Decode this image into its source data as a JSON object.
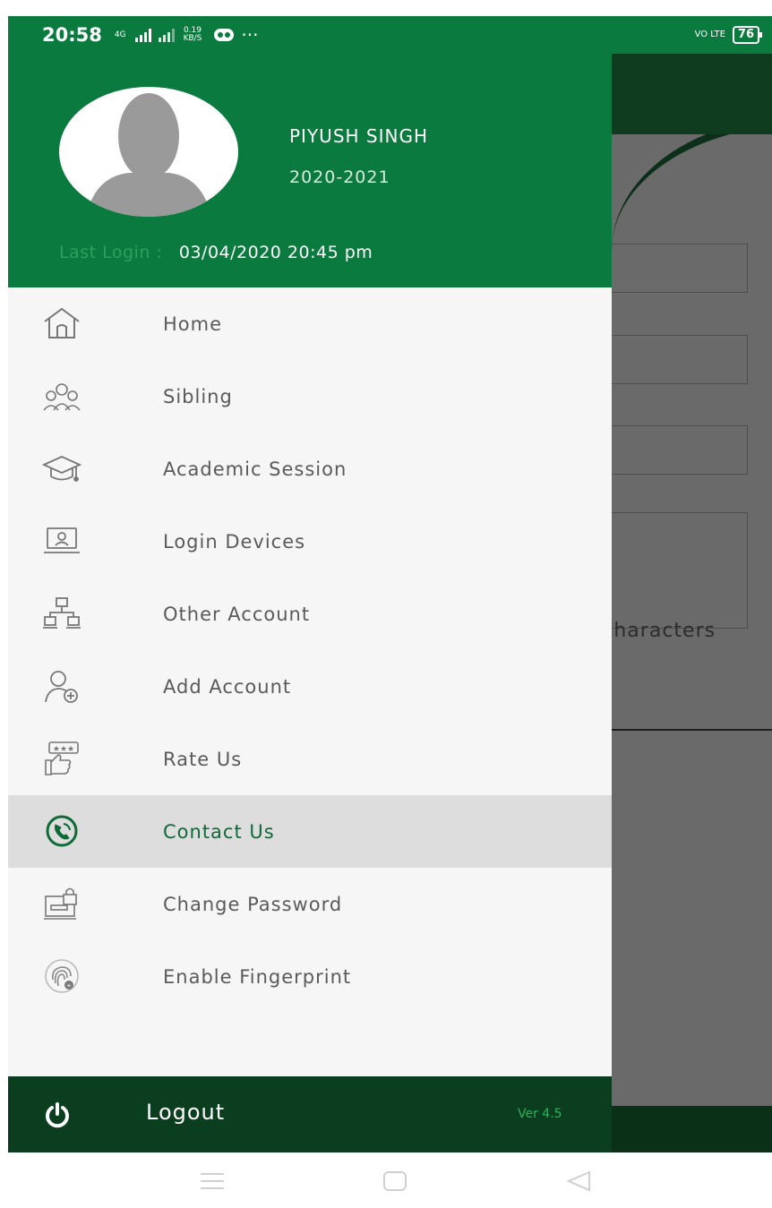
{
  "status_bar": {
    "time": "20:58",
    "network_type": "4G",
    "net_speed_value": "0.19",
    "net_speed_unit": "KB/S",
    "overflow": "···",
    "volte": "VO LTE",
    "battery": "76"
  },
  "profile": {
    "name": "PIYUSH  SINGH",
    "session": "2020-2021",
    "last_login_label": "Last Login :",
    "last_login_value": "03/04/2020  20:45 pm"
  },
  "menu": {
    "items": [
      {
        "label": "Home",
        "icon": "home-icon"
      },
      {
        "label": "Sibling",
        "icon": "sibling-icon"
      },
      {
        "label": "Academic Session",
        "icon": "graduation-cap-icon"
      },
      {
        "label": "Login Devices",
        "icon": "laptop-user-icon"
      },
      {
        "label": "Other Account",
        "icon": "network-computers-icon"
      },
      {
        "label": "Add Account",
        "icon": "add-user-icon"
      },
      {
        "label": "Rate Us",
        "icon": "rating-thumbs-up-icon"
      },
      {
        "label": "Contact Us",
        "icon": "phone-call-icon",
        "active": true
      },
      {
        "label": "Change Password",
        "icon": "password-lock-icon"
      },
      {
        "label": "Enable Fingerprint",
        "icon": "fingerprint-icon"
      }
    ]
  },
  "footer": {
    "logout_label": "Logout",
    "version": "Ver 4.5"
  },
  "background": {
    "hint_text": "Characters"
  },
  "colors": {
    "primary_green": "#0a7a3e",
    "dark_green": "#0b3d1f",
    "active_text": "#0e6a36",
    "active_bg": "#dddddd"
  }
}
